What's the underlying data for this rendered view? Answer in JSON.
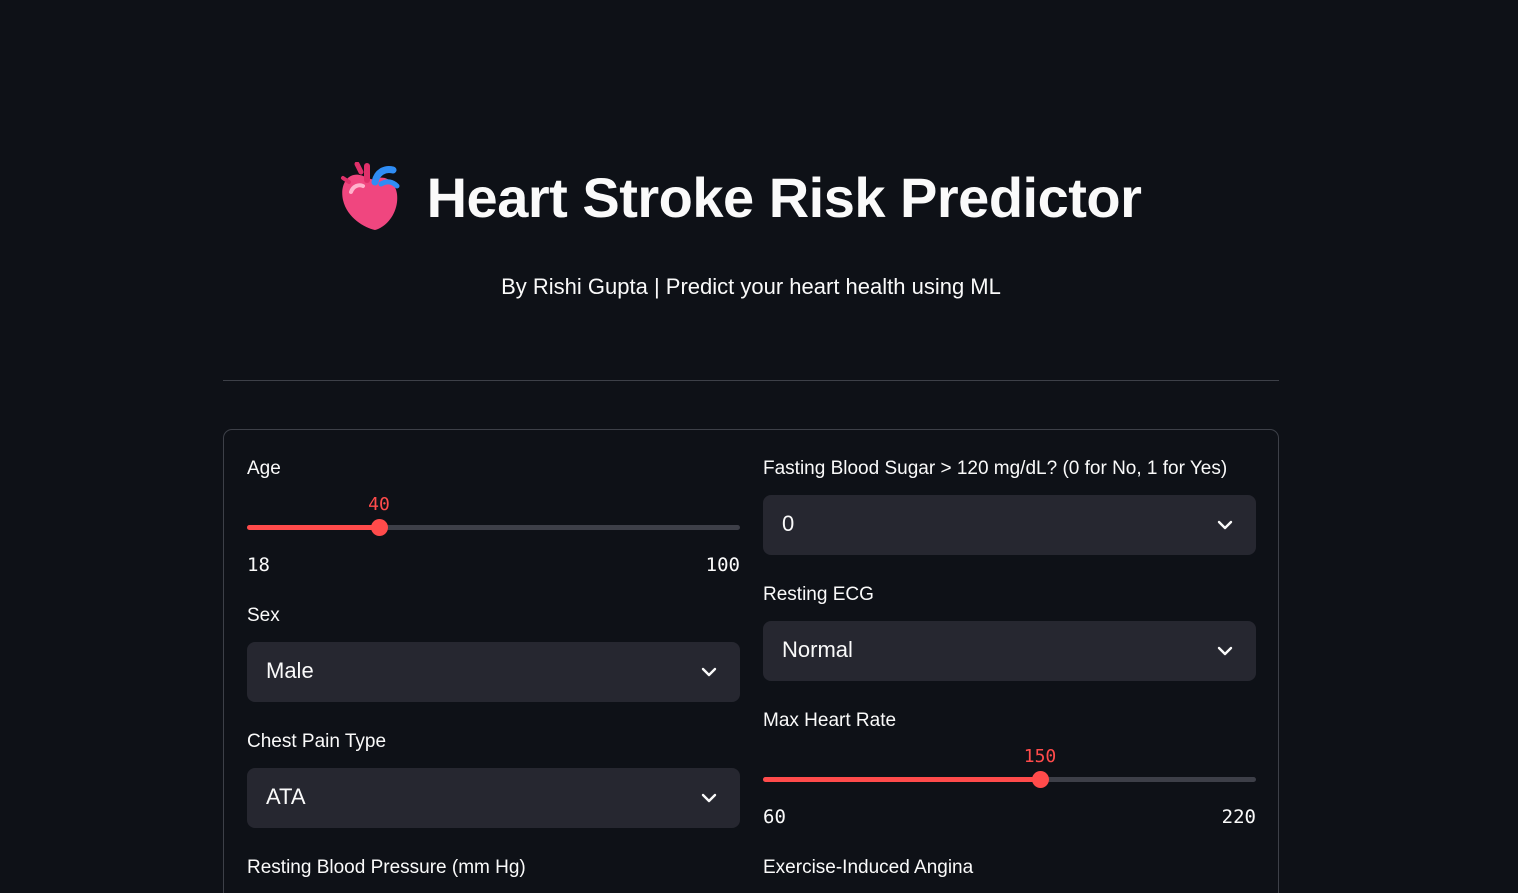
{
  "header": {
    "title": "Heart Stroke Risk Predictor",
    "subtitle": "By Rishi Gupta | Predict your heart health using ML",
    "icon": "anatomical-heart-icon"
  },
  "colors": {
    "background": "#0e1117",
    "accent": "#ff4b4b",
    "input_bg": "#262730",
    "border": "#3d4048"
  },
  "form": {
    "left": {
      "age": {
        "label": "Age",
        "value": "40",
        "min": "18",
        "max": "100",
        "level": 0.268
      },
      "sex": {
        "label": "Sex",
        "value": "Male"
      },
      "chest_pain": {
        "label": "Chest Pain Type",
        "value": "ATA"
      },
      "resting_bp": {
        "label": "Resting Blood Pressure (mm Hg)"
      }
    },
    "right": {
      "fasting_bs": {
        "label": "Fasting Blood Sugar > 120 mg/dL? (0 for No, 1 for Yes)",
        "value": "0"
      },
      "resting_ecg": {
        "label": "Resting ECG",
        "value": "Normal"
      },
      "max_hr": {
        "label": "Max Heart Rate",
        "value": "150",
        "min": "60",
        "max": "220",
        "level": 0.5625
      },
      "exercise_angina": {
        "label": "Exercise-Induced Angina"
      }
    }
  }
}
